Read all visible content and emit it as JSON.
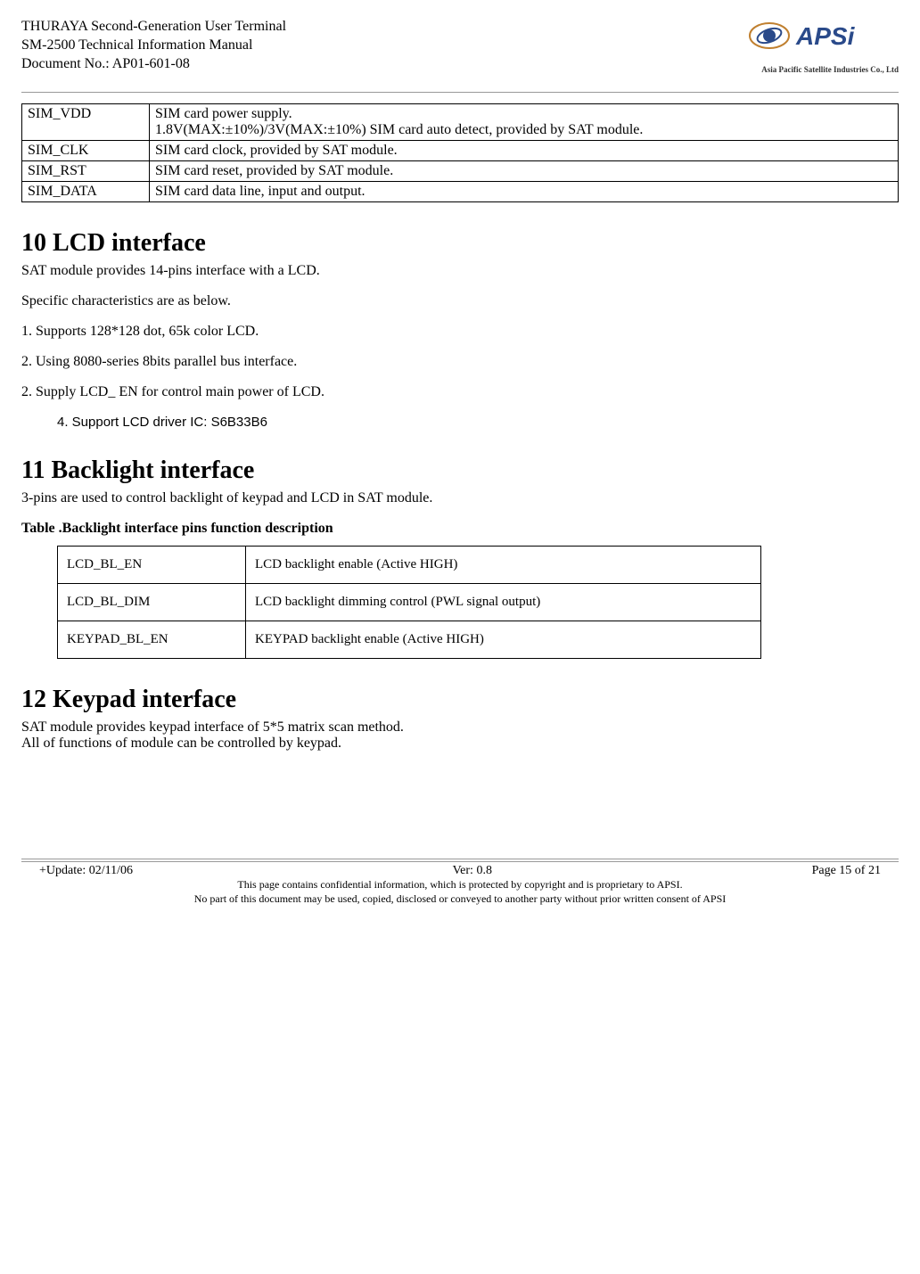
{
  "header": {
    "line1": "THURAYA Second-Generation User Terminal",
    "line2": "SM-2500 Technical Information Manual",
    "line3": "Document No.: AP01-601-08",
    "logo_caption": "Asia Pacific Satellite Industries Co., Ltd"
  },
  "sim_table": {
    "rows": [
      {
        "pin": "SIM_VDD",
        "desc": "SIM card power supply.\n1.8V(MAX:±10%)/3V(MAX:±10%) SIM card auto detect, provided by SAT module."
      },
      {
        "pin": "SIM_CLK",
        "desc": "SIM card clock, provided by SAT module."
      },
      {
        "pin": "SIM_RST",
        "desc": "SIM card reset, provided by SAT module."
      },
      {
        "pin": "SIM_DATA",
        "desc": "SIM card data line, input and output."
      }
    ]
  },
  "section10": {
    "heading": "10 LCD interface",
    "p1": "SAT module provides 14-pins interface with a LCD.",
    "p2": "Specific characteristics are as below.",
    "i1": "1. Supports 128*128 dot, 65k color LCD.",
    "i2": "2. Using 8080-series 8bits parallel bus interface.",
    "i3": "2. Supply LCD_ EN for control main power of LCD.",
    "i4": "4. Support LCD driver IC: S6B33B6"
  },
  "section11": {
    "heading": "11 Backlight interface",
    "p1": "3-pins are used to control backlight of keypad and LCD in SAT module.",
    "caption": "Table .Backlight interface pins function description",
    "rows": [
      {
        "pin": "LCD_BL_EN",
        "desc": "LCD backlight enable (Active HIGH)"
      },
      {
        "pin": "LCD_BL_DIM",
        "desc": "LCD backlight dimming control (PWL signal output)"
      },
      {
        "pin": "KEYPAD_BL_EN",
        "desc": "KEYPAD backlight enable (Active HIGH)"
      }
    ]
  },
  "section12": {
    "heading": "12 Keypad interface",
    "p1": "SAT module provides keypad interface of 5*5 matrix scan method.",
    "p2": "All of functions of module can be controlled by keypad."
  },
  "footer": {
    "update": "+Update: 02/11/06",
    "version": "Ver: 0.8",
    "page": "Page 15 of 21",
    "conf1": "This page contains confidential information, which is protected by copyright and is proprietary to APSI.",
    "conf2": "No part of this document may be used, copied, disclosed or conveyed to another party without prior written consent of APSI"
  }
}
